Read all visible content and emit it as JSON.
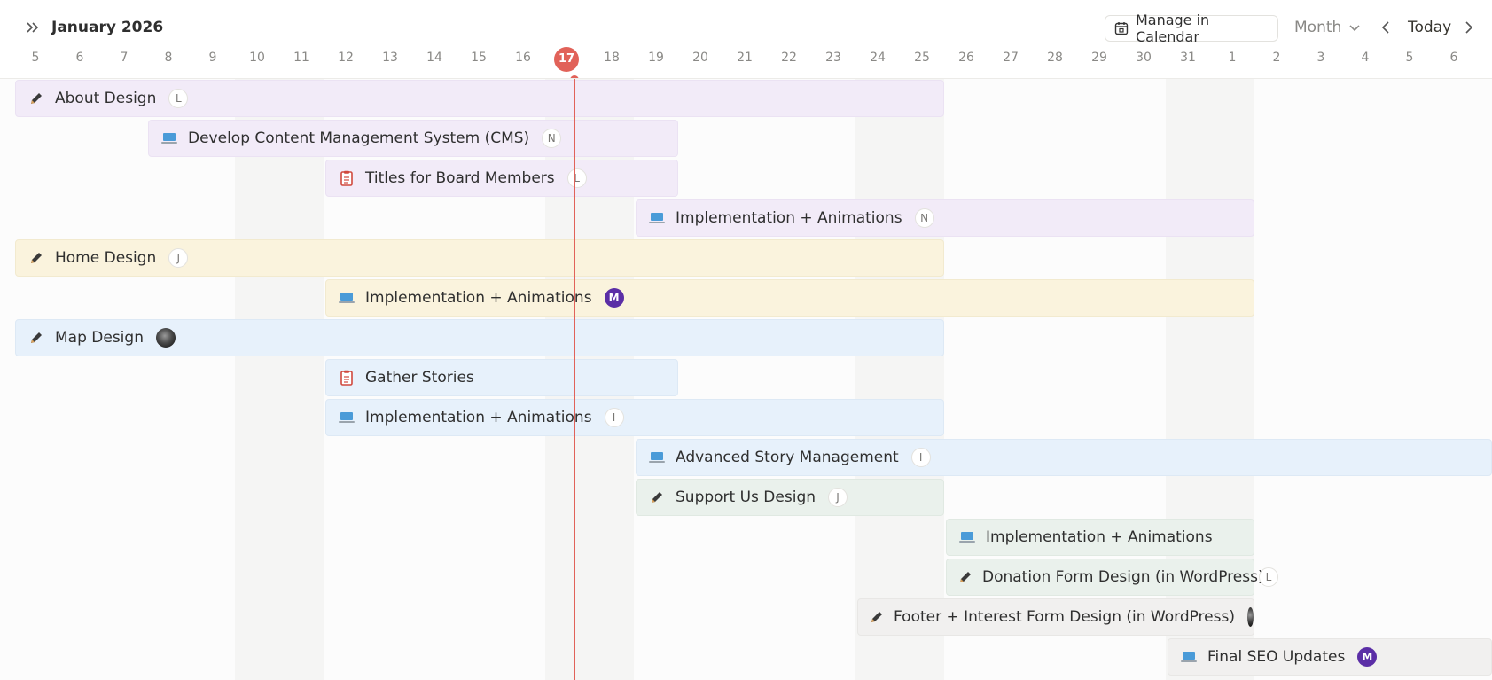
{
  "header": {
    "title": "January 2026",
    "calendar_button": "Manage in Calendar",
    "view_select": "Month",
    "today_button": "Today"
  },
  "timeline": {
    "days": [
      "5",
      "6",
      "7",
      "8",
      "9",
      "10",
      "11",
      "12",
      "13",
      "14",
      "15",
      "16",
      "17",
      "18",
      "19",
      "20",
      "21",
      "22",
      "23",
      "24",
      "25",
      "26",
      "27",
      "28",
      "29",
      "30",
      "31",
      "1",
      "2",
      "3",
      "4",
      "5",
      "6"
    ],
    "today": "17"
  },
  "colors": {
    "purple": "#f2ebf8",
    "yellow": "#faf3dd",
    "blue": "#e7f1fb",
    "green": "#eaf1ec",
    "grey": "#f1f0ef",
    "today": "#e16259",
    "avatar_m": "#5b2ea6"
  },
  "tasks": [
    {
      "label": "About Design",
      "icon": "pencil-icon",
      "avatar": "L"
    },
    {
      "label": "Develop Content Management System (CMS)",
      "icon": "laptop-icon",
      "avatar": "N"
    },
    {
      "label": "Titles for Board Members",
      "icon": "clipboard-icon",
      "avatar": "L"
    },
    {
      "label": "Implementation + Animations",
      "icon": "laptop-icon",
      "avatar": "N"
    },
    {
      "label": "Home Design",
      "icon": "pencil-icon",
      "avatar": "J"
    },
    {
      "label": "Implementation + Animations",
      "icon": "laptop-icon",
      "avatar": "M"
    },
    {
      "label": "Map Design",
      "icon": "pencil-icon",
      "avatar": "photo-avatar"
    },
    {
      "label": "Gather Stories",
      "icon": "clipboard-icon",
      "avatar": ""
    },
    {
      "label": "Implementation + Animations",
      "icon": "laptop-icon",
      "avatar": "I"
    },
    {
      "label": "Advanced Story Management",
      "icon": "laptop-icon",
      "avatar": "I"
    },
    {
      "label": "Support Us Design",
      "icon": "pencil-icon",
      "avatar": "J"
    },
    {
      "label": "Implementation + Animations",
      "icon": "laptop-icon",
      "avatar": ""
    },
    {
      "label": "Donation Form Design (in WordPress)",
      "icon": "pencil-icon",
      "avatar": "L"
    },
    {
      "label": "Footer + Interest Form Design (in WordPress)",
      "icon": "pencil-icon",
      "avatar": "photo-avatar"
    },
    {
      "label": "Final SEO Updates",
      "icon": "laptop-icon",
      "avatar": "M"
    }
  ]
}
